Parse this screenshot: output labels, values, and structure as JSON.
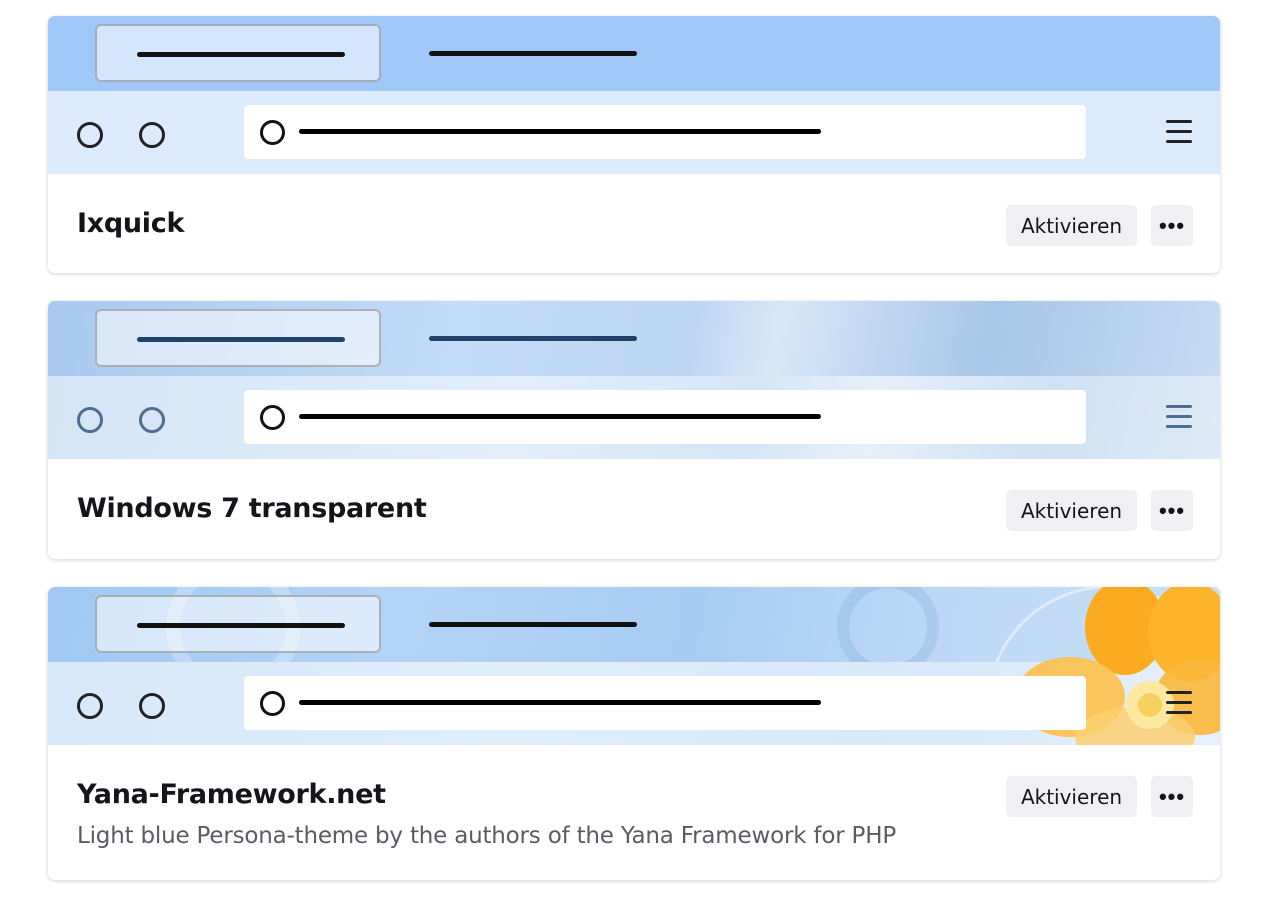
{
  "themes": [
    {
      "name": "Ixquick",
      "description": "",
      "activate_label": "Aktivieren",
      "more_label": "•••",
      "colors": {
        "tabbar": "#9fc8f9",
        "toolbar": "#dcebfd",
        "tab_line": "#111111",
        "toolbar_icons": "#222222"
      }
    },
    {
      "name": "Windows 7 transparent",
      "description": "",
      "activate_label": "Aktivieren",
      "more_label": "•••",
      "colors": {
        "tabbar": "#b7d5f2",
        "toolbar": "#dceaf8",
        "tab_line": "#23426b",
        "toolbar_icons": "#4e6e8f"
      }
    },
    {
      "name": "Yana-Framework.net",
      "description": "Light blue Persona-theme by the authors of the Yana Framework for PHP",
      "activate_label": "Aktivieren",
      "more_label": "•••",
      "colors": {
        "tabbar": "#a9cdf4",
        "toolbar": "#d9eafb",
        "tab_line": "#111111",
        "toolbar_icons": "#222222",
        "flower": "#fbab20"
      }
    }
  ]
}
